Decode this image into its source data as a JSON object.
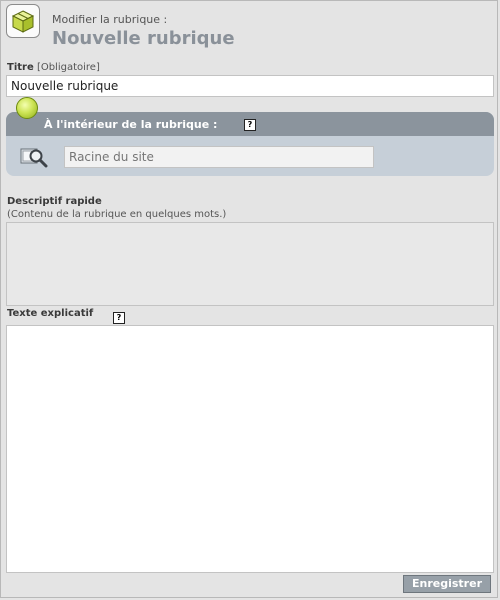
{
  "header": {
    "subtitle": "Modifier la rubrique :",
    "title": "Nouvelle rubrique",
    "icon": "box-icon"
  },
  "titre": {
    "label": "Titre",
    "hint": "[Obligatoire]",
    "value": "Nouvelle rubrique"
  },
  "parent_section": {
    "title": "À l'intérieur de la rubrique :",
    "help": "?",
    "search_icon": "magnifier-icon",
    "placeholder": "Racine du site",
    "accent": "#8b949d"
  },
  "descriptif": {
    "label": "Descriptif rapide",
    "hint": "(Contenu de la rubrique en quelques mots.)",
    "value": ""
  },
  "texte": {
    "label": "Texte explicatif",
    "help": "?",
    "value": ""
  },
  "actions": {
    "save_label": "Enregistrer"
  }
}
